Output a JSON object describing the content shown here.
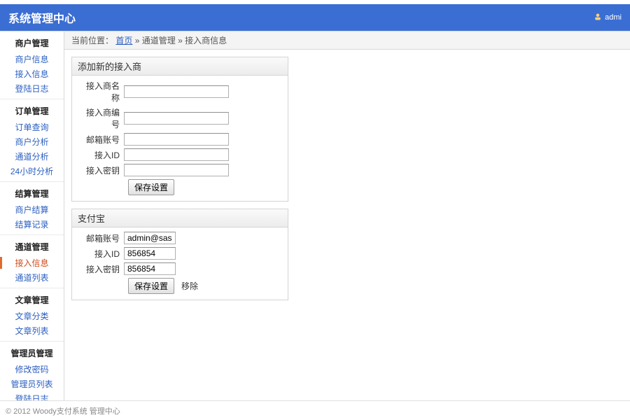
{
  "header": {
    "title": "系统管理中心",
    "user_label": "admi"
  },
  "breadcrumb": {
    "prefix": "当前位置：",
    "home": "首页",
    "sep": " » ",
    "level1": "通道管理",
    "level2": "接入商信息"
  },
  "sidebar": {
    "groups": [
      {
        "title": "商户管理",
        "items": [
          "商户信息",
          "接入信息",
          "登陆日志"
        ]
      },
      {
        "title": "订单管理",
        "items": [
          "订单查询",
          "商户分析",
          "通道分析",
          "24小时分析"
        ]
      },
      {
        "title": "结算管理",
        "items": [
          "商户结算",
          "结算记录"
        ]
      },
      {
        "title": "通道管理",
        "items": [
          "接入信息",
          "通道列表"
        ],
        "active": 0
      },
      {
        "title": "文章管理",
        "items": [
          "文章分类",
          "文章列表"
        ]
      },
      {
        "title": "管理员管理",
        "items": [
          "修改密码",
          "管理员列表",
          "登陆日志"
        ]
      }
    ]
  },
  "add_panel": {
    "title": "添加新的接入商",
    "fields": {
      "name": {
        "label": "接入商名称",
        "value": ""
      },
      "code": {
        "label": "接入商编号",
        "value": ""
      },
      "email": {
        "label": "邮箱账号",
        "value": ""
      },
      "access_id": {
        "label": "接入ID",
        "value": ""
      },
      "access_key": {
        "label": "接入密钥",
        "value": ""
      }
    },
    "save_label": "保存设置"
  },
  "alipay_panel": {
    "title": "支付宝",
    "fields": {
      "email": {
        "label": "邮箱账号",
        "value": "admin@sasadown.cn"
      },
      "access_id": {
        "label": "接入ID",
        "value": "856854"
      },
      "access_key": {
        "label": "接入密钥",
        "value": "856854"
      }
    },
    "save_label": "保存设置",
    "remove_label": "移除"
  },
  "footer": {
    "text": "© 2012 Woody支付系统 管理中心"
  }
}
